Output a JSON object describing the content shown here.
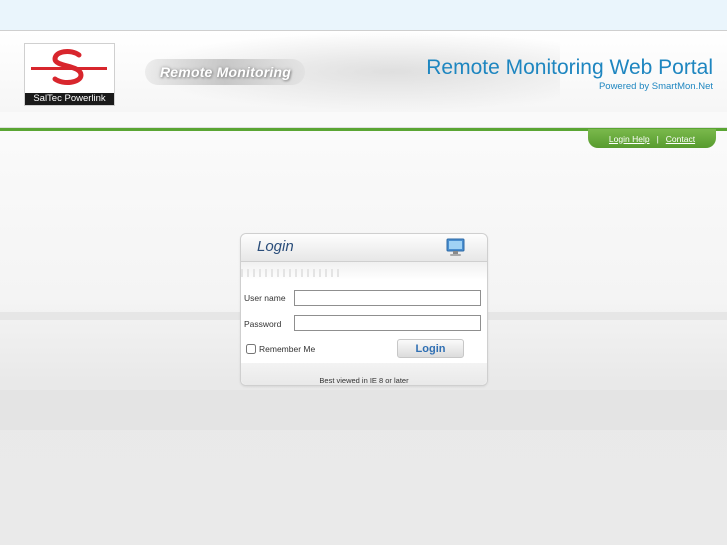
{
  "header": {
    "logo_caption": "SalTec Powerlink",
    "banner_text": "Remote Monitoring",
    "portal_title": "Remote Monitoring Web Portal",
    "portal_subtitle": "Powered by SmartMon.Net"
  },
  "nav": {
    "login_help": "Login Help",
    "separator": "|",
    "contact": "Contact"
  },
  "login": {
    "title": "Login",
    "username_label": "User name",
    "username_value": "",
    "password_label": "Password",
    "password_value": "",
    "remember_label": "Remember Me",
    "remember_checked": false,
    "button_label": "Login",
    "footer_note": "Best viewed in IE 8 or later"
  },
  "colors": {
    "accent_blue": "#1e86c0",
    "nav_green": "#5aa533",
    "logo_red": "#d8262d"
  },
  "icons": {
    "panel_icon": "computer-monitor-icon"
  }
}
